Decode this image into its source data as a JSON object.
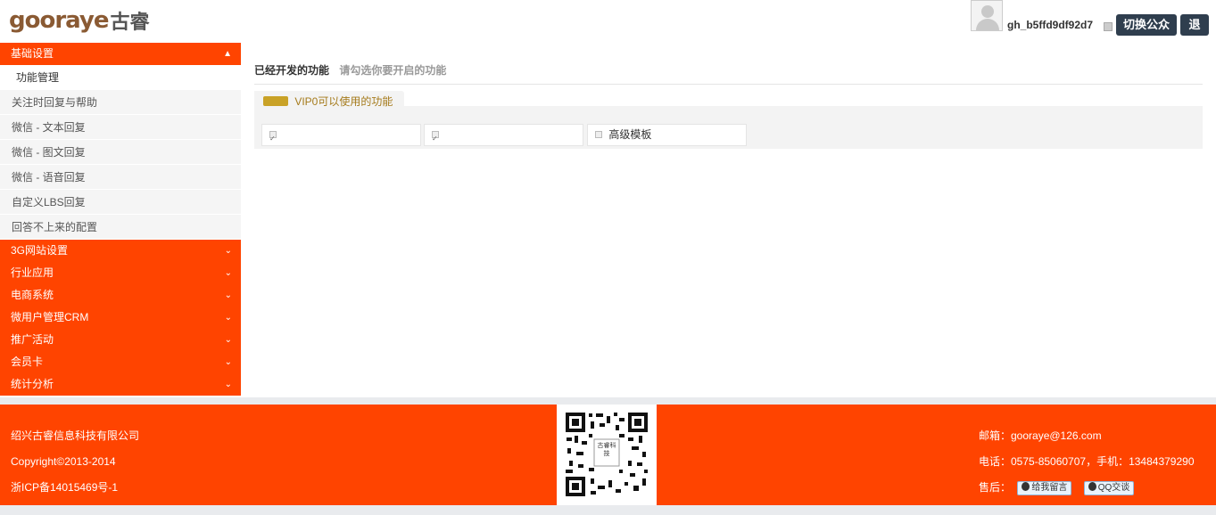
{
  "header": {
    "logo_word": "gooraye",
    "logo_cn": "古睿",
    "username": "gh_b5ffd9df92d7",
    "switch_label": "切换公众号",
    "exit_label": "退出"
  },
  "sidebar": {
    "expanded": {
      "label": "基础设置",
      "items": [
        "功能管理",
        "关注时回复与帮助",
        "微信 - 文本回复",
        "微信 - 图文回复",
        "微信 - 语音回复",
        "自定义LBS回复",
        "回答不上来的配置"
      ]
    },
    "collapsed": [
      "3G网站设置",
      "行业应用",
      "电商系统",
      "微用户管理CRM",
      "推广活动",
      "会员卡",
      "统计分析"
    ]
  },
  "main": {
    "title": "已经开发的功能",
    "subtitle": "请勾选你要开启的功能",
    "panel_label": "VIP0可以使用的功能",
    "features": [
      {
        "label": "",
        "checked": true
      },
      {
        "label": "",
        "checked": true
      },
      {
        "label": "高级模板",
        "checked": false
      }
    ]
  },
  "footer": {
    "company": "绍兴古睿信息科技有限公司",
    "copyright": "Copyright©2013-2014",
    "icp": "浙ICP备14015469号-1",
    "qr_text": "古睿科技",
    "email": "邮箱：gooraye@126.com",
    "phone": "电话：0575-85060707，手机：13484379290",
    "after_sales": "售后：",
    "btn_message": "给我留言",
    "btn_qq": "QQ交谈"
  },
  "colors": {
    "accent": "#ff4400",
    "button_dark": "#2f3e4e"
  }
}
